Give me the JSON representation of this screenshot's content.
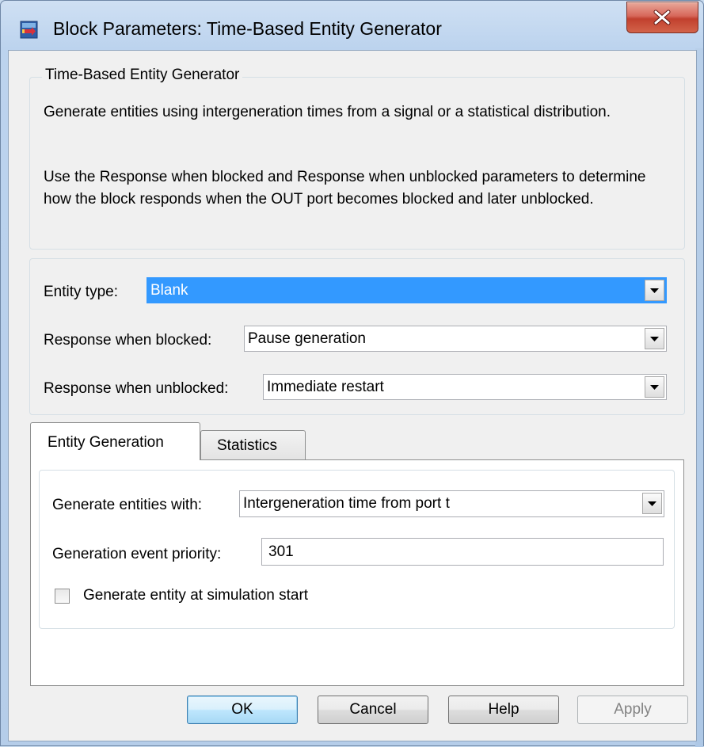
{
  "window": {
    "title": "Block Parameters: Time-Based Entity Generator"
  },
  "description": {
    "group_title": "Time-Based Entity Generator",
    "paragraph1": "Generate entities using intergeneration times from a signal or a statistical distribution.",
    "paragraph2": "Use the Response when blocked and Response when unblocked parameters to determine how the block responds when the OUT port becomes blocked and later unblocked."
  },
  "params": {
    "entity_type_label": "Entity type:",
    "entity_type_value": "Blank",
    "blocked_label": "Response when blocked:",
    "blocked_value": "Pause generation",
    "unblocked_label": "Response when unblocked:",
    "unblocked_value": "Immediate restart"
  },
  "tabs": [
    {
      "label": "Entity Generation",
      "active": true
    },
    {
      "label": "Statistics",
      "active": false
    }
  ],
  "entity_generation": {
    "generate_with_label": "Generate entities with:",
    "generate_with_value": "Intergeneration time from port t",
    "priority_label": "Generation event priority:",
    "priority_value": "301",
    "start_checkbox_label": "Generate entity at simulation start",
    "start_checkbox_checked": false
  },
  "buttons": {
    "ok": "OK",
    "cancel": "Cancel",
    "help": "Help",
    "apply": "Apply"
  },
  "colors": {
    "selection": "#3399ff",
    "close_button": "#c1402e",
    "default_button_border": "#3c7fb1"
  }
}
